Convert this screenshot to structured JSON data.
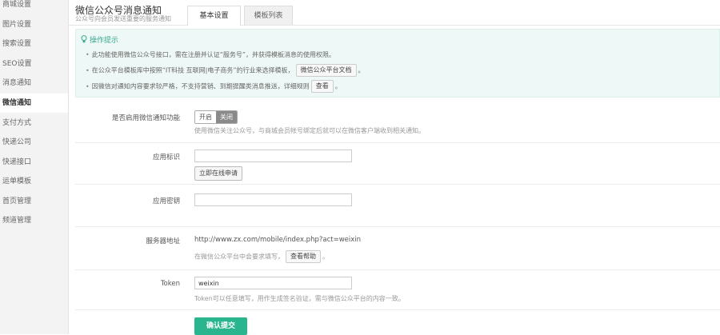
{
  "sidebar": {
    "items": [
      {
        "label": "商城设置",
        "active": false
      },
      {
        "label": "图片设置",
        "active": false
      },
      {
        "label": "搜索设置",
        "active": false
      },
      {
        "label": "SEO设置",
        "active": false
      },
      {
        "label": "消息通知",
        "active": false
      },
      {
        "label": "微信通知",
        "active": true
      },
      {
        "label": "支付方式",
        "active": false
      },
      {
        "label": "快递公司",
        "active": false
      },
      {
        "label": "快递接口",
        "active": false
      },
      {
        "label": "运单模板",
        "active": false
      },
      {
        "label": "首页管理",
        "active": false
      },
      {
        "label": "频道管理",
        "active": false
      }
    ]
  },
  "header": {
    "title": "微信公众号消息通知",
    "subtitle": "公众号向会员发送重要的服务通知"
  },
  "tabs": [
    {
      "label": "基本设置",
      "active": true
    },
    {
      "label": "模板列表",
      "active": false
    }
  ],
  "tips": {
    "title": "操作提示",
    "line1": "此功能使用微信公众号接口，需在注册并认证“服务号”，并获得模板消息的使用权限。",
    "line2_prefix": "在公众平台模板库中按照“IT科技 互联网|电子商务”的行业来选择模板，",
    "line2_button": "微信公众平台文档",
    "line2_suffix": "。",
    "line3_prefix": "因微信对通知内容要求较严格，不支持营销、到期提醒类消息推送，详细规则",
    "line3_button": "查看",
    "line3_suffix": "。"
  },
  "form": {
    "enable": {
      "label": "是否启用微信通知功能",
      "on_label": "开启",
      "off_label": "关闭",
      "selected": "关闭",
      "hint": "使用微信关注公众号，与商城会员帐号绑定后就可以在微信客户端收到相关通知。"
    },
    "app_id": {
      "label": "应用标识",
      "value": "",
      "apply_button": "立即在线申请"
    },
    "app_secret": {
      "label": "应用密钥",
      "value": ""
    },
    "server_url": {
      "label": "服务器地址",
      "value": "http://www.zx.com/mobile/index.php?act=weixin",
      "hint_prefix": "在微信公众平台中会要求填写，",
      "hint_button": "查看帮助",
      "hint_suffix": "。"
    },
    "token": {
      "label": "Token",
      "value": "weixin",
      "hint": "Token可以任意填写，用作生成签名验证，需与微信公众平台的内容一致。"
    },
    "submit_label": "确认提交"
  },
  "colors": {
    "accent": "#2bb58f",
    "tip_background": "#eef8f6",
    "tip_title": "#3aa88f",
    "sidebar_background": "#f3f3f3"
  }
}
